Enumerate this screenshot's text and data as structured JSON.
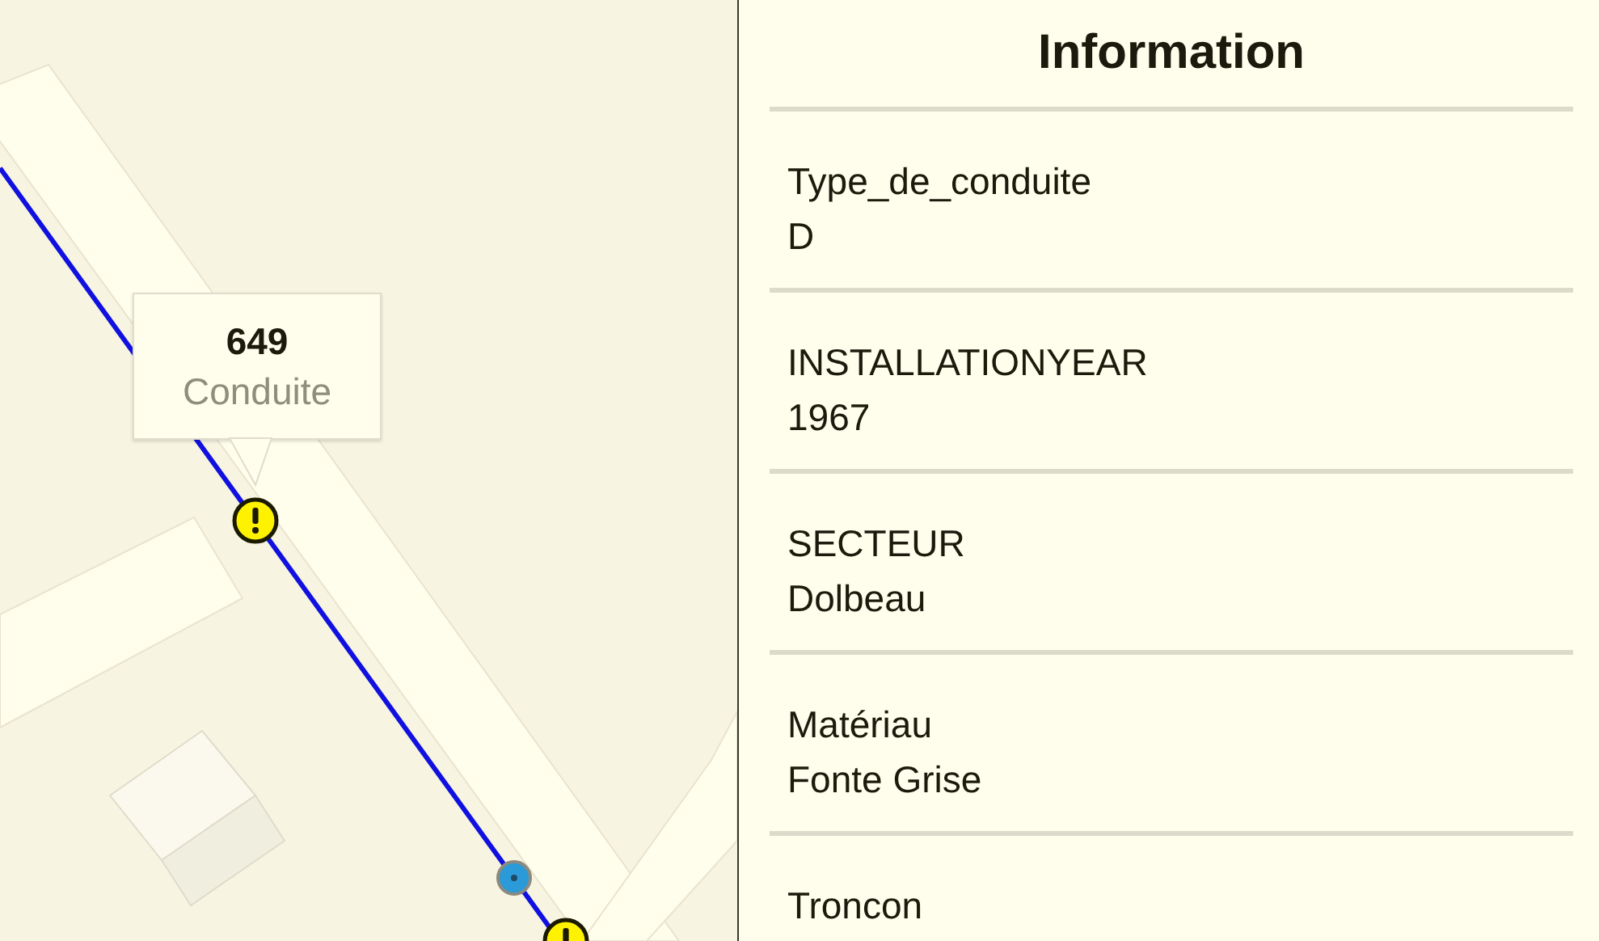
{
  "map": {
    "callout": {
      "title": "649",
      "subtitle": "Conduite"
    },
    "markers": [
      {
        "kind": "warning"
      },
      {
        "kind": "valve"
      },
      {
        "kind": "warning"
      }
    ]
  },
  "panel": {
    "title": "Information",
    "fields": [
      {
        "label": "Type_de_conduite",
        "value": "D"
      },
      {
        "label": "INSTALLATIONYEAR",
        "value": "1967"
      },
      {
        "label": "SECTEUR",
        "value": "Dolbeau"
      },
      {
        "label": "Matériau",
        "value": "Fonte Grise"
      },
      {
        "label": "Troncon"
      }
    ]
  }
}
